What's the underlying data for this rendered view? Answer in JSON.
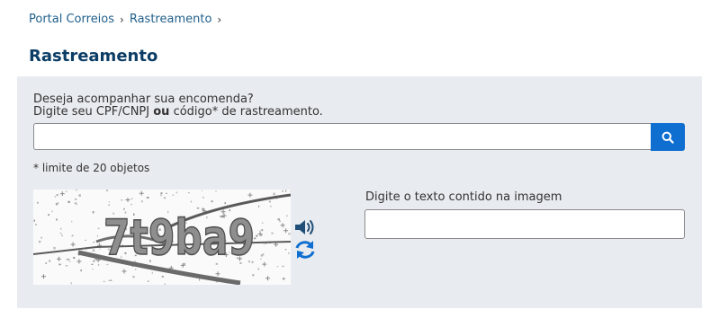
{
  "breadcrumb": {
    "items": [
      "Portal Correios",
      "Rastreamento"
    ],
    "separator": "›"
  },
  "page_title": "Rastreamento",
  "form": {
    "prompt_line1": "Deseja acompanhar sua encomenda?",
    "prompt_line2_before": "Digite seu CPF/CNPJ ",
    "prompt_line2_bold": "ou",
    "prompt_line2_after": " código* de rastreamento.",
    "search_value": "",
    "search_placeholder": "",
    "search_icon": "search-icon",
    "limit_note": "* limite de 20 objetos"
  },
  "captcha": {
    "image_text": "7t9ba9",
    "audio_icon": "speaker-icon",
    "refresh_icon": "refresh-icon",
    "label": "Digite o texto contido na imagem",
    "input_value": "",
    "input_placeholder": ""
  },
  "colors": {
    "brand_blue": "#0f6fd1",
    "title_blue": "#0b3d66",
    "link_blue": "#1f5f8b",
    "panel_bg": "#e8ebef"
  }
}
